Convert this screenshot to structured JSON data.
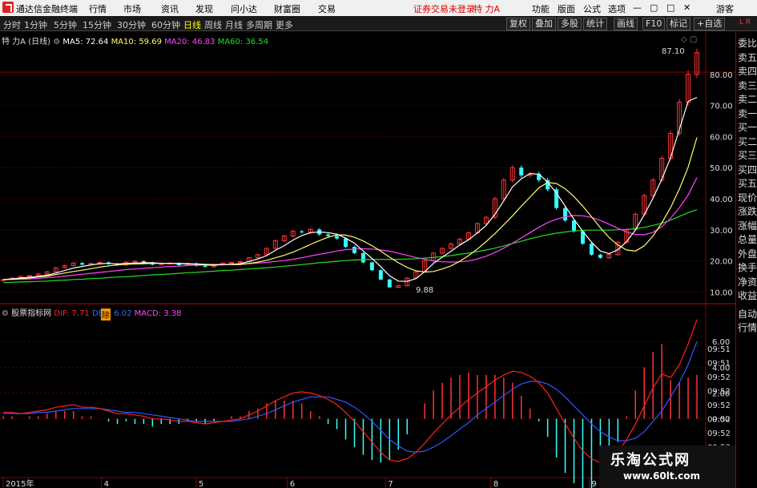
{
  "app": {
    "title": "通达信金融终端"
  },
  "menu": [
    "行情",
    "市场",
    "资讯",
    "发现",
    "问小达",
    "财富圈",
    "交易"
  ],
  "status": {
    "login": "证券交易未登录",
    "stock": "特 力A"
  },
  "menu_right": [
    "功能",
    "版面",
    "公式",
    "选项"
  ],
  "guest": "游客",
  "periods": [
    "分时",
    "1分钟",
    "5分钟",
    "15分钟",
    "30分钟",
    "60分钟",
    "日线",
    "周线",
    "月线",
    "多周期",
    "更多"
  ],
  "toolbar": [
    "复权",
    "叠加",
    "多股",
    "统计",
    "画线",
    "F10",
    "标记",
    "+自选"
  ],
  "main_legend": {
    "name": "特 力A",
    "period": "(日线)",
    "ma5": "MA5: 72.64",
    "ma10": "MA10: 59.69",
    "ma20": "MA20: 46.83",
    "ma60": "MA60: 36.54"
  },
  "sub_legend": {
    "name": "股票指标网",
    "dif": "DIF: 7.71",
    "dea": "DEA: 6.02",
    "macd": "MACD: 3.38"
  },
  "annotations": {
    "high": "87.10",
    "low": "9.88",
    "badge": "除"
  },
  "main_axis": [
    "80.00",
    "70.00",
    "60.00",
    "50.00",
    "40.00",
    "30.00",
    "20.00",
    "10.00"
  ],
  "sub_axis": [
    "6.00",
    "4.00",
    "2.00",
    "0.00"
  ],
  "date_axis": [
    "2015年",
    "4",
    "5",
    "6",
    "7",
    "8",
    "9"
  ],
  "right_panel": [
    "委比",
    "卖五",
    "卖四",
    "卖三",
    "卖二",
    "卖一",
    "买一",
    "买二",
    "买三",
    "买四",
    "买五",
    "现价",
    "涨跌",
    "涨幅",
    "总量",
    "外盘",
    "换手",
    "净资",
    "收益"
  ],
  "right_panel_bottom": [
    "自动",
    "行情"
  ],
  "times": [
    "09:51",
    "09:51",
    "09:52",
    "09:52",
    "09:52",
    "09:52",
    "09:52",
    "09:53"
  ],
  "corner": "L R",
  "watermark": {
    "line1": "乐淘公式网",
    "line2": "www.60lt.com"
  },
  "colors": {
    "up": "#ff3333",
    "down": "#33ffff",
    "ma5": "#ffffff",
    "ma10": "#ffff66",
    "ma20": "#ff44ff",
    "ma60": "#22dd22",
    "dif": "#ff2020",
    "dea": "#3355ff",
    "grid": "#880000"
  },
  "chart_data": {
    "type": "line",
    "price_ylim": [
      7,
      90
    ],
    "macd_ylim": [
      -4,
      8
    ],
    "close": [
      14,
      14.5,
      15,
      15.3,
      15.8,
      16.5,
      17.8,
      18.5,
      19.3,
      18.8,
      19.2,
      19.5,
      19,
      18.7,
      19.6,
      19.9,
      19.4,
      18.8,
      19.2,
      19.3,
      18.6,
      19.2,
      18.4,
      18.1,
      18.8,
      19.3,
      19.5,
      19.8,
      21,
      22,
      24,
      26.5,
      28,
      29.5,
      29.2,
      30.1,
      28.5,
      28,
      27.2,
      24.5,
      22.5,
      19.5,
      17,
      14,
      11.5,
      12,
      14.5,
      16.5,
      20,
      22.5,
      24,
      25.5,
      27,
      29,
      32,
      34,
      40,
      46,
      50,
      47.5,
      48,
      46,
      43,
      37,
      33,
      29.5,
      25.5,
      22,
      21,
      22,
      26,
      30,
      35,
      41,
      46,
      53,
      61,
      71,
      80,
      87
    ],
    "ma5": [
      14,
      14.2,
      14.5,
      14.7,
      15,
      15.4,
      16.1,
      16.9,
      17.7,
      18.2,
      18.7,
      19.1,
      19.2,
      19,
      19.2,
      19.3,
      19.4,
      19.4,
      19.2,
      19.2,
      19.1,
      19,
      18.9,
      18.7,
      18.6,
      18.8,
      18.9,
      19.1,
      19.8,
      20.6,
      21.7,
      23.4,
      24.9,
      26.7,
      28.1,
      29.1,
      29.3,
      29.1,
      28.6,
      27.3,
      25.7,
      23.2,
      20.8,
      18.1,
      15.2,
      13.5,
      13.4,
      14.3,
      16.5,
      19.2,
      21.2,
      23.1,
      25.1,
      26.8,
      29,
      31.4,
      35,
      39.3,
      43.8,
      46.4,
      48.1,
      47.9,
      45.4,
      41.8,
      37.6,
      33.4,
      29.5,
      26,
      23.2,
      22.3,
      23.6,
      26.2,
      30,
      34.8,
      40.2,
      46.3,
      53.2,
      62.3,
      71.3,
      72.6
    ],
    "ma10": [
      14,
      14.1,
      14.3,
      14.5,
      14.8,
      15.1,
      15.6,
      16.1,
      16.6,
      17,
      17.5,
      18,
      18.4,
      18.7,
      18.9,
      19,
      19.1,
      19.2,
      19.2,
      19.2,
      19.2,
      19.1,
      19,
      18.9,
      18.8,
      18.8,
      18.8,
      18.8,
      19.2,
      19.6,
      20.2,
      21,
      21.8,
      22.8,
      24,
      25.3,
      26.5,
      27.6,
      28.4,
      28.3,
      27.6,
      26.4,
      24.9,
      23.1,
      21.2,
      19.4,
      17.9,
      16.8,
      16.4,
      16.6,
      17.4,
      18.4,
      19.9,
      21.7,
      23.8,
      26.2,
      28.8,
      31.6,
      34.5,
      37.6,
      40.5,
      43.5,
      45.2,
      44.9,
      43.2,
      40.7,
      37.6,
      34.2,
      30.7,
      27.5,
      25.1,
      23.5,
      23.2,
      24.8,
      28,
      32.2,
      37.1,
      43.1,
      50.1,
      59.7
    ],
    "ma20": [
      14,
      14,
      14.1,
      14.2,
      14.4,
      14.6,
      14.8,
      15.1,
      15.4,
      15.7,
      16,
      16.3,
      16.6,
      16.9,
      17.2,
      17.4,
      17.6,
      17.8,
      18,
      18.2,
      18.3,
      18.5,
      18.6,
      18.7,
      18.8,
      18.9,
      18.9,
      19,
      19.1,
      19.3,
      19.5,
      19.8,
      20.1,
      20.5,
      21,
      21.6,
      22.1,
      22.6,
      23.2,
      23.6,
      23.8,
      23.9,
      23.8,
      23.5,
      23.1,
      22.5,
      21.8,
      21.1,
      20.5,
      20,
      19.7,
      19.6,
      19.7,
      20,
      20.6,
      21.5,
      22.7,
      24.1,
      25.7,
      27.4,
      29.1,
      30.8,
      32.3,
      33.4,
      34.2,
      34.6,
      34.5,
      34,
      33,
      31.8,
      30.5,
      29.3,
      28.5,
      28.4,
      29.2,
      31,
      33.7,
      37.1,
      41.2,
      46.8
    ],
    "ma60": [
      13,
      13.1,
      13.2,
      13.3,
      13.4,
      13.5,
      13.7,
      13.8,
      14,
      14.1,
      14.3,
      14.4,
      14.6,
      14.8,
      14.9,
      15.1,
      15.3,
      15.5,
      15.6,
      15.8,
      16,
      16.2,
      16.3,
      16.5,
      16.7,
      16.9,
      17,
      17.2,
      17.4,
      17.6,
      17.8,
      18,
      18.3,
      18.5,
      18.8,
      19.1,
      19.4,
      19.6,
      19.9,
      20.1,
      20.3,
      20.4,
      20.5,
      20.5,
      20.5,
      20.5,
      20.6,
      20.7,
      20.9,
      21.1,
      21.4,
      21.7,
      22.1,
      22.5,
      23,
      23.5,
      24.1,
      24.8,
      25.6,
      26.3,
      27.1,
      27.8,
      28.4,
      28.9,
      29.3,
      29.6,
      29.8,
      29.9,
      29.9,
      29.9,
      30,
      30.1,
      30.4,
      30.8,
      31.4,
      32.1,
      33.1,
      34.3,
      35.5,
      36.5
    ],
    "dif": [
      0.5,
      0.5,
      0.4,
      0.5,
      0.6,
      0.7,
      0.9,
      1,
      1.1,
      0.9,
      0.9,
      0.8,
      0.6,
      0.4,
      0.4,
      0.3,
      0.2,
      0,
      0,
      -0.1,
      -0.2,
      -0.2,
      -0.3,
      -0.4,
      -0.3,
      -0.2,
      -0.1,
      0,
      0.3,
      0.6,
      1,
      1.4,
      1.7,
      2,
      2.1,
      2,
      1.8,
      1.5,
      1.1,
      0.5,
      -0.2,
      -1,
      -1.8,
      -2.6,
      -3.2,
      -3.3,
      -3.1,
      -2.6,
      -1.9,
      -1.1,
      -0.4,
      0.3,
      0.9,
      1.5,
      2,
      2.5,
      3,
      3.4,
      3.7,
      3.6,
      3.3,
      2.8,
      2,
      0.8,
      -0.4,
      -1.5,
      -2.5,
      -3.1,
      -3.4,
      -3.2,
      -2.6,
      -1.6,
      -0.4,
      1,
      2.4,
      3.5,
      3.2,
      4.2,
      5.8,
      7.7
    ],
    "dea": [
      0.4,
      0.4,
      0.4,
      0.4,
      0.5,
      0.5,
      0.6,
      0.7,
      0.8,
      0.8,
      0.8,
      0.8,
      0.7,
      0.6,
      0.5,
      0.5,
      0.4,
      0.3,
      0.2,
      0.1,
      0,
      -0.1,
      -0.2,
      -0.2,
      -0.2,
      -0.2,
      -0.2,
      -0.1,
      0,
      0.2,
      0.4,
      0.7,
      1,
      1.3,
      1.5,
      1.7,
      1.7,
      1.7,
      1.5,
      1.3,
      0.9,
      0.4,
      -0.2,
      -0.9,
      -1.6,
      -2.1,
      -2.5,
      -2.6,
      -2.5,
      -2.2,
      -1.8,
      -1.3,
      -0.8,
      -0.3,
      0.3,
      0.8,
      1.3,
      1.8,
      2.3,
      2.7,
      2.9,
      2.9,
      2.7,
      2.3,
      1.7,
      1,
      0.3,
      -0.4,
      -1,
      -1.4,
      -1.7,
      -1.7,
      -1.5,
      -1,
      -0.2,
      0.6,
      1.7,
      2.8,
      4.2,
      6
    ]
  }
}
